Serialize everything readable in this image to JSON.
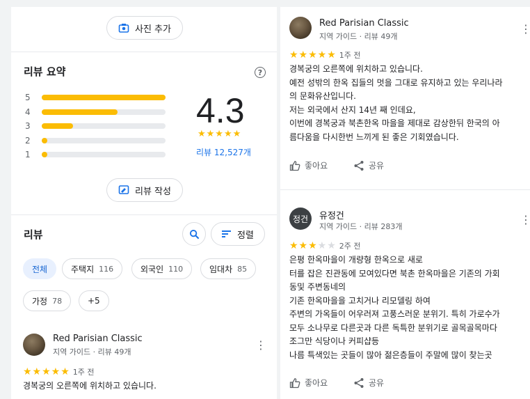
{
  "left": {
    "add_photo_label": "사진 추가",
    "summary_title": "리뷰 요약",
    "help_icon": "?",
    "bars": [
      {
        "label": "5",
        "fraction": 1.0
      },
      {
        "label": "4",
        "fraction": 0.61
      },
      {
        "label": "3",
        "fraction": 0.25
      },
      {
        "label": "2",
        "fraction": 0.04
      },
      {
        "label": "1",
        "fraction": 0.04
      }
    ],
    "rating": "4.3",
    "rating_stars": "★★★★★",
    "review_count": "리뷰 12,527개",
    "write_review_label": "리뷰 작성",
    "reviews_title": "리뷰",
    "sort_label": "정렬",
    "chips": [
      {
        "label": "전체",
        "count": ""
      },
      {
        "label": "주택지",
        "count": "116"
      },
      {
        "label": "외국인",
        "count": "110"
      },
      {
        "label": "임대차",
        "count": "85"
      },
      {
        "label": "가정",
        "count": "78"
      },
      {
        "label": "+5",
        "count": ""
      }
    ],
    "review": {
      "name": "Red Parisian Classic",
      "meta": "지역 가이드 · 리뷰 49개",
      "stars": "★★★★★",
      "time": "1주 전",
      "text": "경복궁의 오른쪽에 위치하고 있습니다."
    }
  },
  "right": {
    "reviews": [
      {
        "name": "Red Parisian Classic",
        "meta": "지역 가이드 · 리뷰 49개",
        "stars_on": "★★★★★",
        "stars_off": "",
        "rating": 5,
        "time": "1주 전",
        "lines": [
          "경복궁의 오른쪽에 위치하고 있습니다.",
          "예전 성밖의 한옥 집들의 멋을 그대로 유지하고 있는 우리나라",
          "의 문화유산입니다.",
          "저는 외국에서 산지 14년 째 인데요,",
          "이번에 경복궁과 북촌한옥 마을을 제대로 감상한뒤 한국의 아",
          "름다움을 다시한번 느끼게 된 좋은 기회였습니다."
        ],
        "like_label": "좋아요",
        "share_label": "공유"
      },
      {
        "name": "유정건",
        "avatar_text": "정건",
        "meta": "지역 가이드 · 리뷰 283개",
        "stars_on": "★★★",
        "stars_off": "★★",
        "rating": 3,
        "time": "2주 전",
        "lines": [
          "은평 한옥마을이 개량형 한옥으로 새로",
          "터를 잡은 진관동에 모여있다면 북촌 한옥마을은 기존의 가회",
          "동및 주변동네의",
          "기존 한옥마을을 고치거나 리모델링 하여",
          "주변의 가옥들이 어우러져 고풍스러운 분위기. 특히 가로수가",
          "모두 소나무로  다른곳과 다른 독특한 분위기로 골목골목마다",
          "조그만 식당이나 커피샵등",
          "나름 특색있는 곳들이 많아 젊은층들이 주말에 많이 찾는곳"
        ],
        "like_label": "좋아요",
        "share_label": "공유"
      }
    ]
  },
  "colors": {
    "accent": "#1a73e8",
    "star": "#fbbc04",
    "chip_active_bg": "#e8f0fe"
  }
}
